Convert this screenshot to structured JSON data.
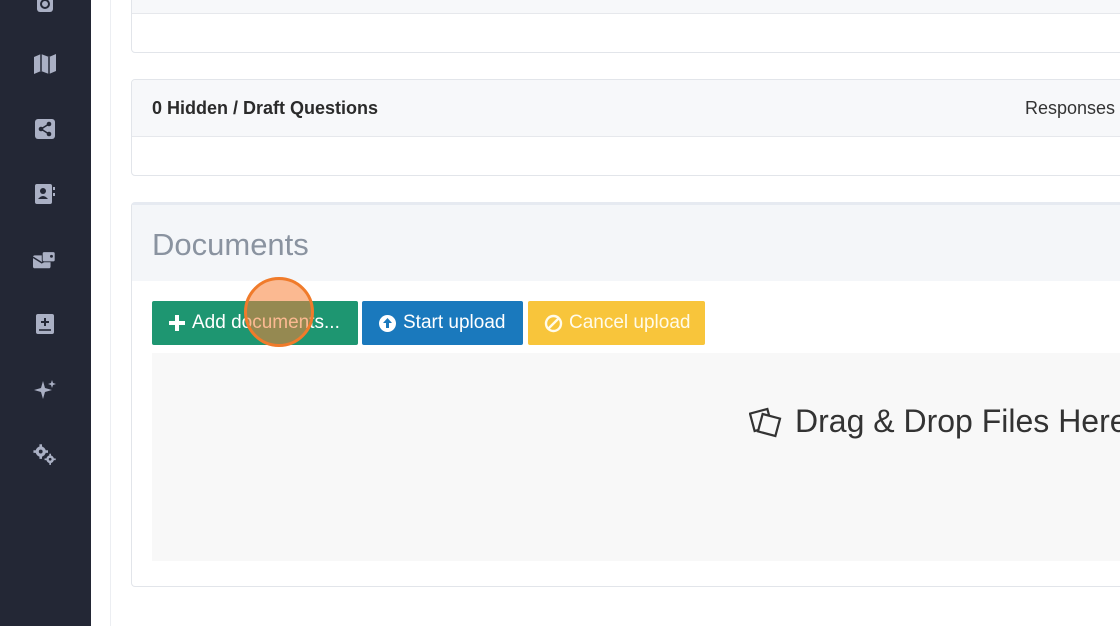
{
  "sidebar": {
    "items": [
      {
        "icon": "copyright-icon"
      },
      {
        "icon": "map-icon"
      },
      {
        "icon": "share-icon"
      },
      {
        "icon": "contact-card-icon"
      },
      {
        "icon": "inbox-icon"
      },
      {
        "icon": "add-note-icon"
      },
      {
        "icon": "sparkles-icon"
      },
      {
        "icon": "settings-gears-icon"
      }
    ]
  },
  "hidden_panel": {
    "title": "0 Hidden / Draft Questions",
    "responses_label": "Responses"
  },
  "documents": {
    "title": "Documents",
    "add_label": "Add documents...",
    "start_label": "Start upload",
    "cancel_label": "Cancel upload",
    "drop_label": "Drag & Drop Files Here"
  },
  "colors": {
    "sidebar_bg": "#232735",
    "add_button": "#1e9671",
    "start_button": "#1a79bd",
    "cancel_button": "#f8c53b",
    "cursor_highlight": "#f07b2b"
  }
}
